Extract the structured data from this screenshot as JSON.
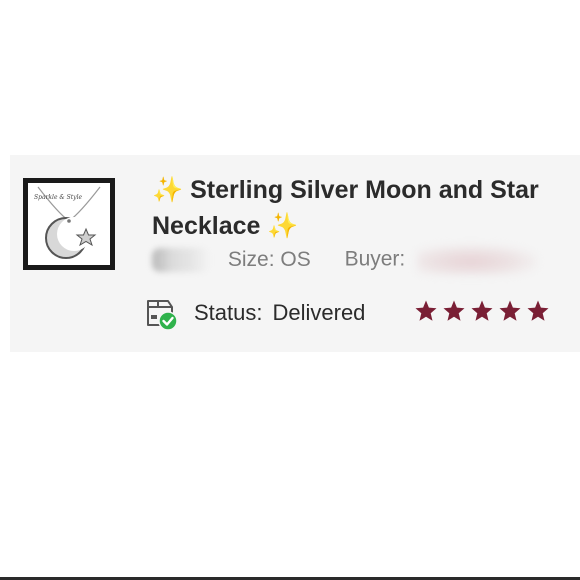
{
  "listing": {
    "title_line1": "Sterling Silver Moon and Star",
    "title_line2": "Necklace",
    "sparkle": "✨",
    "thumbnail_icon": "moon-star-necklace-photo",
    "thumbnail_watermark": "Sparkle & Style"
  },
  "meta": {
    "size_label": "Size: OS",
    "buyer_label": "Buyer:"
  },
  "status": {
    "label": "Status:",
    "value": "Delivered",
    "icon": "delivered-box-icon"
  },
  "rating": {
    "stars": 5,
    "max": 5,
    "color": "#7a1f35"
  },
  "colors": {
    "accent_green": "#2fb24c",
    "star_color": "#7a1f35",
    "sparkle_color": "#f2c94c"
  }
}
